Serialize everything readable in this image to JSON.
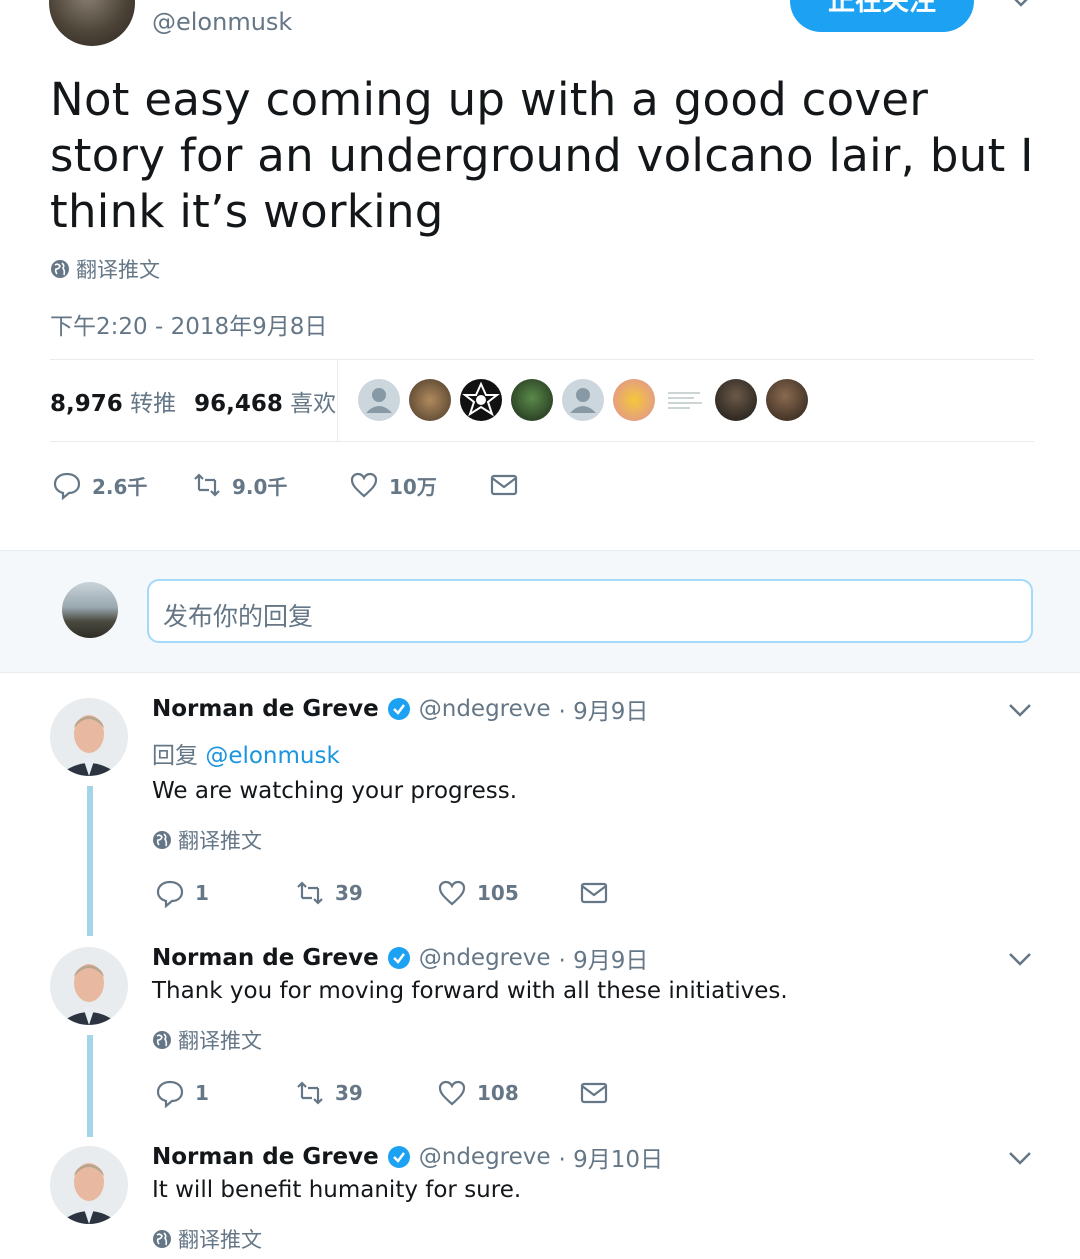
{
  "top": {
    "handle": "@elonmusk",
    "follow_label": "正在关注"
  },
  "tweet": {
    "text": "Not easy coming up with a good cover story for an underground volcano lair, but I think it’s working",
    "translate": "翻译推文",
    "timestamp": "下午2:20 - 2018年9月8日",
    "retweets_count": "8,976",
    "retweets_label": "转推",
    "likes_count": "96,468",
    "likes_label": "喜欢",
    "actions": {
      "replies": "2.6千",
      "retweets": "9.0千",
      "likes": "10万"
    }
  },
  "reply_box": {
    "placeholder": "发布你的回复"
  },
  "replies": [
    {
      "name": "Norman de Greve",
      "handle": "@ndegreve",
      "date": "· 9月9日",
      "reply_prefix": "回复",
      "reply_to": "@elonmusk",
      "text": "We are watching your progress.",
      "translate": "翻译推文",
      "replies": "1",
      "retweets": "39",
      "likes": "105"
    },
    {
      "name": "Norman de Greve",
      "handle": "@ndegreve",
      "date": "· 9月9日",
      "text": "Thank you for moving forward with all these initiatives.",
      "translate": "翻译推文",
      "replies": "1",
      "retweets": "39",
      "likes": "108"
    },
    {
      "name": "Norman de Greve",
      "handle": "@ndegreve",
      "date": "· 9月10日",
      "text": "It will benefit humanity for sure.",
      "translate": "翻译推文"
    }
  ],
  "colors": {
    "accent": "#1da1f2",
    "muted": "#657786",
    "thread_line": "#a4d4e8"
  }
}
